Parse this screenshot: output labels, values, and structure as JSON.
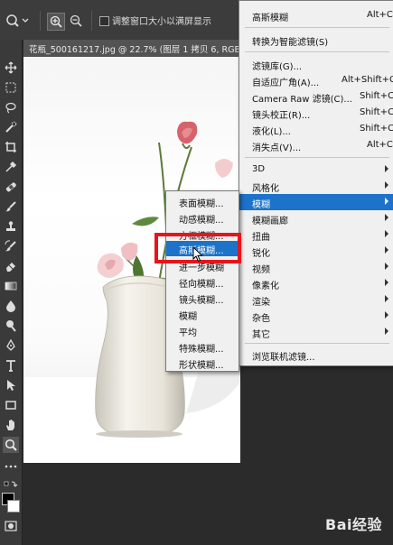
{
  "options_bar": {
    "resize_window_label": "调整窗口大小以满屏显示"
  },
  "document_tab": {
    "title": "花瓶_500161217.jpg @ 22.7% (图层 1 拷贝 6, RGB"
  },
  "filter_menu": {
    "items": [
      {
        "label": "高斯模糊",
        "shortcut": "Alt+C"
      },
      {
        "label": "转换为智能滤镜(S)",
        "shortcut": ""
      },
      {
        "label": "滤镜库(G)...",
        "shortcut": ""
      },
      {
        "label": "自适应广角(A)...",
        "shortcut": "Alt+Shift+Ct"
      },
      {
        "label": "Camera Raw 滤镜(C)...",
        "shortcut": "Shift+Ct"
      },
      {
        "label": "镜头校正(R)...",
        "shortcut": "Shift+Ct"
      },
      {
        "label": "液化(L)...",
        "shortcut": "Shift+Ct"
      },
      {
        "label": "消失点(V)...",
        "shortcut": "Alt+Ct"
      },
      {
        "label": "3D"
      },
      {
        "label": "风格化"
      },
      {
        "label": "模糊"
      },
      {
        "label": "模糊画廊"
      },
      {
        "label": "扭曲"
      },
      {
        "label": "锐化"
      },
      {
        "label": "视频"
      },
      {
        "label": "像素化"
      },
      {
        "label": "渲染"
      },
      {
        "label": "杂色"
      },
      {
        "label": "其它"
      },
      {
        "label": "浏览联机滤镜..."
      }
    ]
  },
  "blur_submenu": {
    "items": [
      {
        "label": "表面模糊..."
      },
      {
        "label": "动感模糊..."
      },
      {
        "label": "方框模糊..."
      },
      {
        "label": "高斯模糊..."
      },
      {
        "label": "进一步模糊"
      },
      {
        "label": "径向模糊..."
      },
      {
        "label": "镜头模糊..."
      },
      {
        "label": "模糊"
      },
      {
        "label": "平均"
      },
      {
        "label": "特殊模糊..."
      },
      {
        "label": "形状模糊..."
      }
    ]
  },
  "watermark": {
    "text": "Bai经验",
    "color": "#ffffff"
  },
  "colors": {
    "menu_highlight": "#1c73c9",
    "annotation_red": "#e8141a"
  }
}
